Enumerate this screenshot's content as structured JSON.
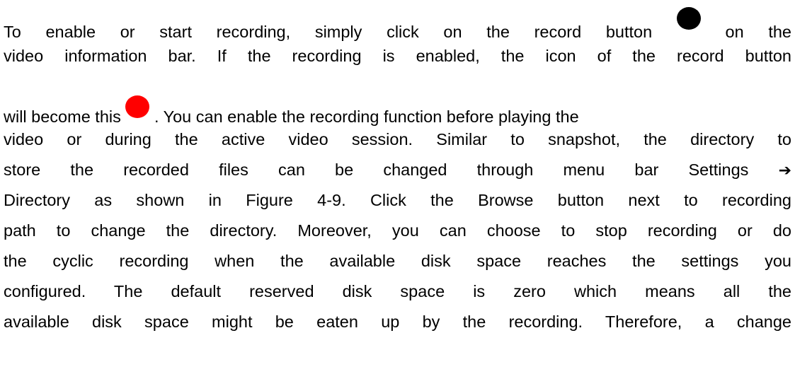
{
  "paragraph": {
    "line1": {
      "before": "To enable or start recording, simply click on the record button",
      "after": "on the",
      "record_icon_color": "#000000"
    },
    "line2": "video information bar. If the recording is enabled, the icon of the record button",
    "line3": {
      "before": "will become this",
      "after": ". You can enable the recording function before playing the",
      "record_icon_color": "#ff0000"
    },
    "line4": "video or during the active video session. Similar to snapshot, the directory to",
    "line5": {
      "before": "store the recorded files can be changed through menu bar Settings",
      "arrow": "➔"
    },
    "line6": "Directory as shown in Figure 4-9. Click the Browse button next to recording",
    "line7": "path to change the directory. Moreover, you can choose to stop recording or do",
    "line8": "the cyclic recording when the available disk space reaches the settings you",
    "line9": "configured. The default reserved disk space is zero which means all the",
    "line10": "available disk space might be eaten up by the recording. Therefore, a change"
  }
}
